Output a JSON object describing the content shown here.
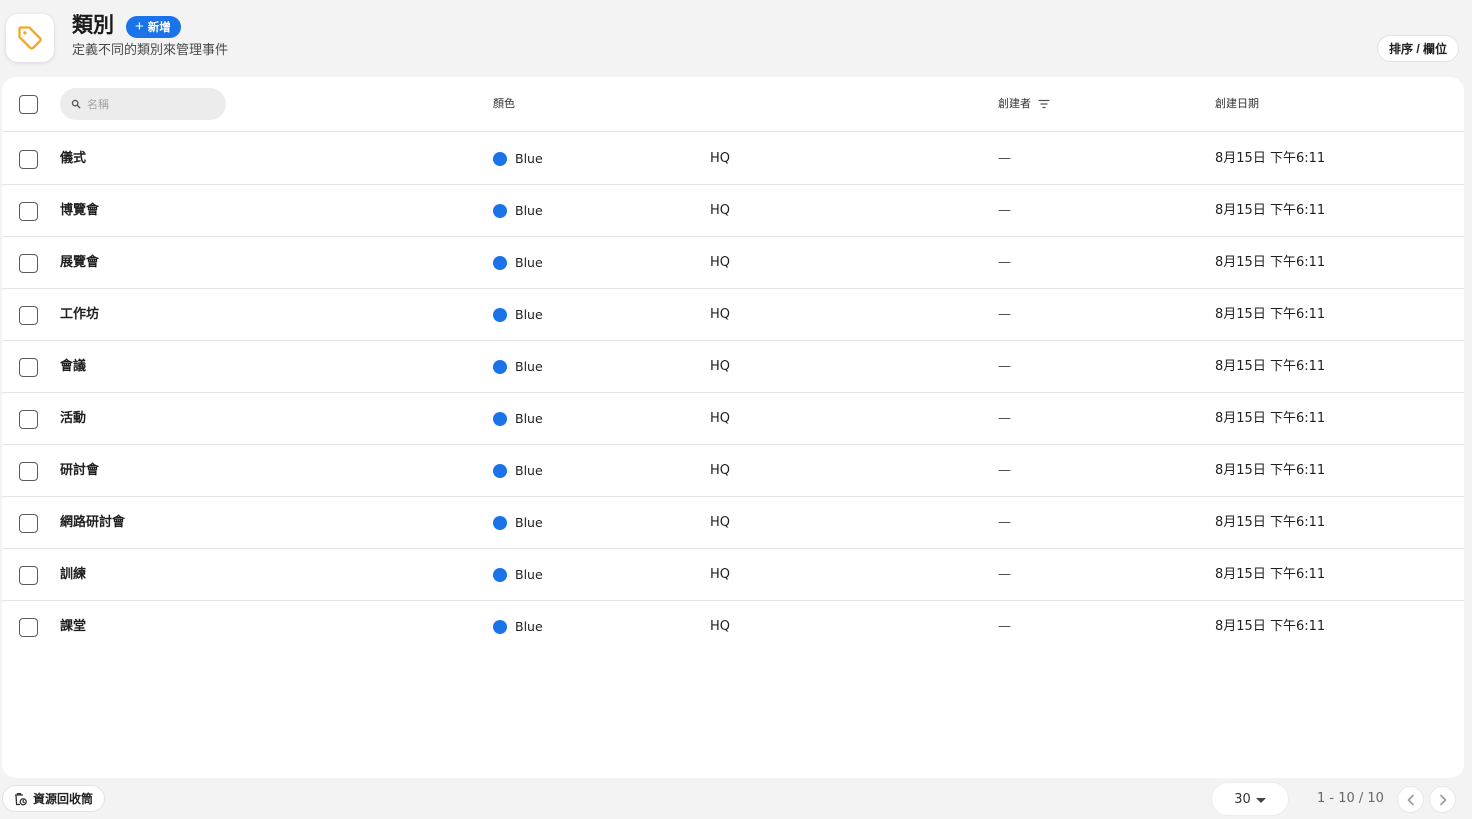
{
  "header": {
    "icon": "tag-icon",
    "title": "類別",
    "add_label": "新增",
    "subtitle": "定義不同的類別來管理事件",
    "sort_label": "排序 / 欄位"
  },
  "table": {
    "search_placeholder": "名稱",
    "columns": {
      "color": "顏色",
      "creator": "創建者",
      "created": "創建日期"
    },
    "rows": [
      {
        "name": "儀式",
        "color": "Blue",
        "org": "HQ",
        "creator": "—",
        "created": "8月15日 下午6:11"
      },
      {
        "name": "博覽會",
        "color": "Blue",
        "org": "HQ",
        "creator": "—",
        "created": "8月15日 下午6:11"
      },
      {
        "name": "展覽會",
        "color": "Blue",
        "org": "HQ",
        "creator": "—",
        "created": "8月15日 下午6:11"
      },
      {
        "name": "工作坊",
        "color": "Blue",
        "org": "HQ",
        "creator": "—",
        "created": "8月15日 下午6:11"
      },
      {
        "name": "會議",
        "color": "Blue",
        "org": "HQ",
        "creator": "—",
        "created": "8月15日 下午6:11"
      },
      {
        "name": "活動",
        "color": "Blue",
        "org": "HQ",
        "creator": "—",
        "created": "8月15日 下午6:11"
      },
      {
        "name": "研討會",
        "color": "Blue",
        "org": "HQ",
        "creator": "—",
        "created": "8月15日 下午6:11"
      },
      {
        "name": "網路研討會",
        "color": "Blue",
        "org": "HQ",
        "creator": "—",
        "created": "8月15日 下午6:11"
      },
      {
        "name": "訓練",
        "color": "Blue",
        "org": "HQ",
        "creator": "—",
        "created": "8月15日 下午6:11"
      },
      {
        "name": "課堂",
        "color": "Blue",
        "org": "HQ",
        "creator": "—",
        "created": "8月15日 下午6:11"
      }
    ]
  },
  "footer": {
    "recycle_label": "資源回收筒",
    "per_page": "30",
    "range": "1 - 10 / 10"
  },
  "colors": {
    "accent": "#1a73e8",
    "tag_icon": "#f5a623",
    "blue_dot": "#1a73e8"
  }
}
